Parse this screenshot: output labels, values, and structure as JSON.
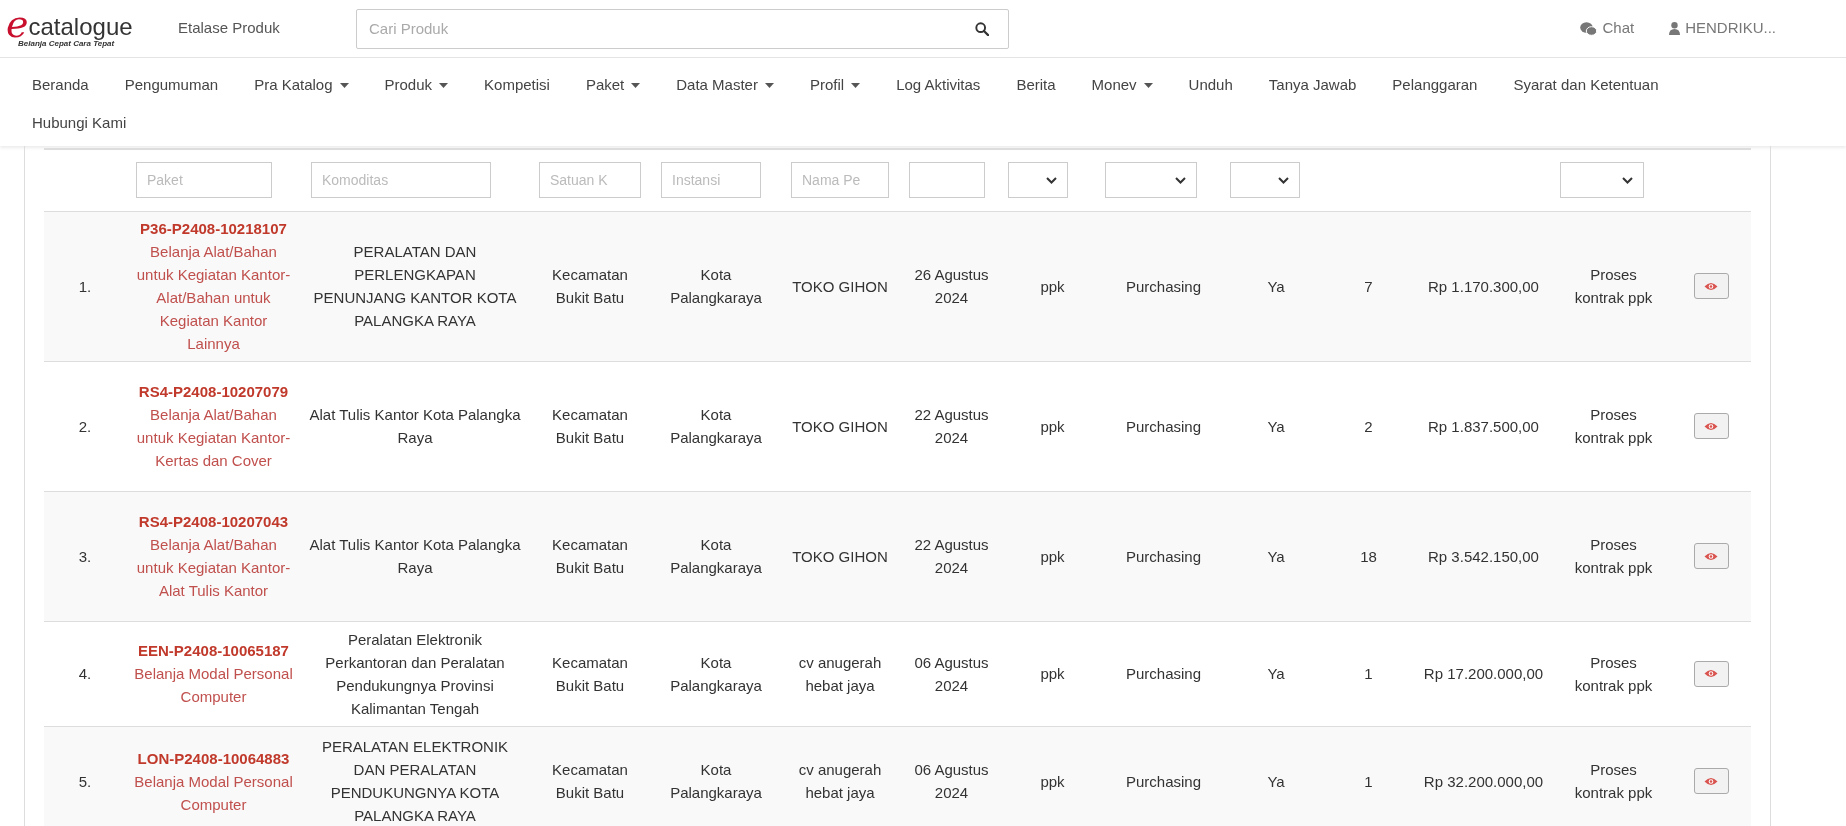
{
  "header": {
    "logo": {
      "letter": "e",
      "word": "catalogue",
      "tagline": "Belanja Cepat Cara Tepat"
    },
    "link": "Etalase Produk",
    "search": {
      "placeholder": "Cari Produk"
    },
    "chat": "Chat",
    "user": "HENDRIKU..."
  },
  "menu": [
    {
      "label": "Beranda",
      "dropdown": false
    },
    {
      "label": "Pengumuman",
      "dropdown": false
    },
    {
      "label": "Pra Katalog",
      "dropdown": true
    },
    {
      "label": "Produk",
      "dropdown": true
    },
    {
      "label": "Kompetisi",
      "dropdown": false
    },
    {
      "label": "Paket",
      "dropdown": true
    },
    {
      "label": "Data Master",
      "dropdown": true
    },
    {
      "label": "Profil",
      "dropdown": true
    },
    {
      "label": "Log Aktivitas",
      "dropdown": false
    },
    {
      "label": "Berita",
      "dropdown": false
    },
    {
      "label": "Monev",
      "dropdown": true
    },
    {
      "label": "Unduh",
      "dropdown": false
    },
    {
      "label": "Tanya Jawab",
      "dropdown": false
    },
    {
      "label": "Pelanggaran",
      "dropdown": false
    },
    {
      "label": "Syarat dan Ketentuan",
      "dropdown": false
    },
    {
      "label": "Hubungi Kami",
      "dropdown": false
    }
  ],
  "table": {
    "filters": [
      {
        "kind": "none"
      },
      {
        "kind": "text",
        "placeholder": "Paket"
      },
      {
        "kind": "text",
        "placeholder": "Komoditas"
      },
      {
        "kind": "text",
        "placeholder": "Satuan K"
      },
      {
        "kind": "text",
        "placeholder": "Instansi"
      },
      {
        "kind": "text",
        "placeholder": "Nama Pe"
      },
      {
        "kind": "text"
      },
      {
        "kind": "select"
      },
      {
        "kind": "select"
      },
      {
        "kind": "select"
      },
      {
        "kind": "none"
      },
      {
        "kind": "none"
      },
      {
        "kind": "select"
      },
      {
        "kind": "none"
      }
    ],
    "rows": [
      {
        "number": "1.",
        "code": "P36-P2408-10218107",
        "name": "Belanja Alat/Bahan untuk Kegiatan Kantor-Alat/Bahan untuk Kegiatan Kantor Lainnya",
        "cells": [
          "PERALATAN DAN PERLENGKAPAN PENUNJANG KANTOR KOTA PALANGKA RAYA",
          "Kecamatan Bukit Batu",
          "Kota Palangkaraya",
          "TOKO GIHON",
          "26 Agustus 2024",
          "ppk",
          "Purchasing",
          "Ya",
          "7",
          "Rp 1.170.300,00",
          "Proses kontrak ppk"
        ]
      },
      {
        "number": "2.",
        "code": "RS4-P2408-10207079",
        "name": "Belanja Alat/Bahan untuk Kegiatan Kantor- Kertas dan Cover",
        "cells": [
          "Alat Tulis Kantor Kota Palangka Raya",
          "Kecamatan Bukit Batu",
          "Kota Palangkaraya",
          "TOKO GIHON",
          "22 Agustus 2024",
          "ppk",
          "Purchasing",
          "Ya",
          "2",
          "Rp 1.837.500,00",
          "Proses kontrak ppk"
        ]
      },
      {
        "number": "3.",
        "code": "RS4-P2408-10207043",
        "name": "Belanja Alat/Bahan untuk Kegiatan Kantor-Alat Tulis Kantor",
        "cells": [
          "Alat Tulis Kantor Kota Palangka Raya",
          "Kecamatan Bukit Batu",
          "Kota Palangkaraya",
          "TOKO GIHON",
          "22 Agustus 2024",
          "ppk",
          "Purchasing",
          "Ya",
          "18",
          "Rp 3.542.150,00",
          "Proses kontrak ppk"
        ]
      },
      {
        "number": "4.",
        "code": "EEN-P2408-10065187",
        "name": "Belanja Modal Personal Computer",
        "cells": [
          "Peralatan Elektronik Perkantoran dan Peralatan Pendukungnya Provinsi Kalimantan Tengah",
          "Kecamatan Bukit Batu",
          "Kota Palangkaraya",
          "cv anugerah hebat jaya",
          "06 Agustus 2024",
          "ppk",
          "Purchasing",
          "Ya",
          "1",
          "Rp 17.200.000,00",
          "Proses kontrak ppk"
        ]
      },
      {
        "number": "5.",
        "code": "LON-P2408-10064883",
        "name": "Belanja Modal Personal Computer",
        "cells": [
          "PERALATAN ELEKTRONIK DAN PERALATAN PENDUKUNGNYA KOTA PALANGKA RAYA",
          "Kecamatan Bukit Batu",
          "Kota Palangkaraya",
          "cv anugerah hebat jaya",
          "06 Agustus 2024",
          "ppk",
          "Purchasing",
          "Ya",
          "1",
          "Rp 32.200.000,00",
          "Proses kontrak ppk"
        ]
      }
    ]
  }
}
